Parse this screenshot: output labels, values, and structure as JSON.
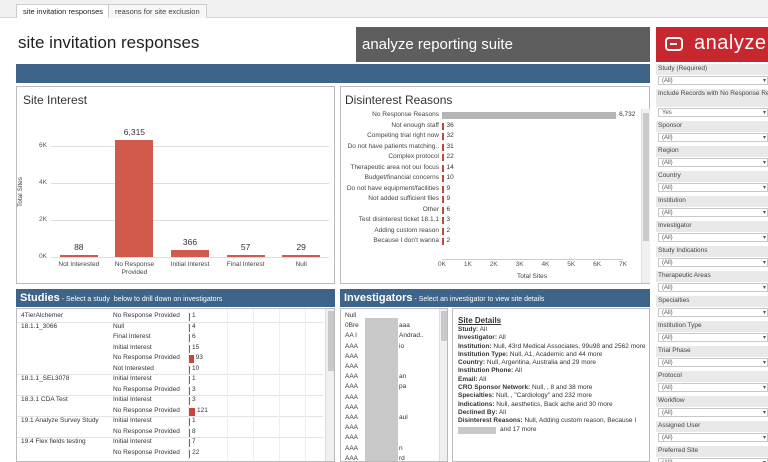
{
  "tabs": [
    {
      "label": "site invitation responses"
    },
    {
      "label": "reasons for site exclusion"
    }
  ],
  "header": {
    "title": "site invitation responses",
    "suite": "analyze reporting suite",
    "brand": "analyze"
  },
  "site_interest": {
    "title": "Site Interest",
    "ylabel": "Total Sites",
    "yticks": [
      "6K",
      "4K",
      "2K",
      "0K"
    ],
    "categories": [
      "Not Interested",
      "No Response Provided",
      "Initial Interest",
      "Final Interest",
      "Null"
    ],
    "value_labels": [
      "88",
      "6,315",
      "366",
      "57",
      "29"
    ],
    "chart_data": {
      "type": "bar",
      "categories": [
        "Not Interested",
        "No Response Provided",
        "Initial Interest",
        "Final Interest",
        "Null"
      ],
      "values": [
        88,
        6315,
        366,
        57,
        29
      ],
      "title": "Site Interest",
      "xlabel": "",
      "ylabel": "Total Sites",
      "ylim": [
        0,
        7000
      ]
    }
  },
  "disinterest": {
    "title": "Disinterest Reasons",
    "xlabel": "Total Sites",
    "xticks": [
      "0K",
      "1K",
      "2K",
      "3K",
      "4K",
      "5K",
      "6K",
      "7K"
    ],
    "labels": [
      "No Response Reasons",
      "Not enough staff",
      "Competing trial right now",
      "Do not have patients matching..",
      "Complex protocol",
      "Therapeutic area not our focus",
      "Budget/financial concerns",
      "Do not have equipment/facilities",
      "Not added sufficient files",
      "Other",
      "Test disinterest ticket 18.1.1",
      "Adding custom reason",
      "Because I don't wanna"
    ],
    "value_labels": [
      "6,732",
      "36",
      "32",
      "31",
      "22",
      "14",
      "10",
      "9",
      "9",
      "6",
      "3",
      "2",
      "2"
    ],
    "chart_data": {
      "type": "bar",
      "orientation": "horizontal",
      "categories": [
        "No Response Reasons",
        "Not enough staff",
        "Competing trial right now",
        "Do not have patients matching..",
        "Complex protocol",
        "Therapeutic area not our focus",
        "Budget/financial concerns",
        "Do not have equipment/facilities",
        "Not added sufficient files",
        "Other",
        "Test disinterest ticket 18.1.1",
        "Adding custom reason",
        "Because I don't wanna"
      ],
      "values": [
        6732,
        36,
        32,
        31,
        22,
        14,
        10,
        9,
        9,
        6,
        3,
        2,
        2
      ],
      "title": "Disinterest Reasons",
      "xlabel": "Total Sites",
      "xlim": [
        0,
        7000
      ]
    }
  },
  "studies": {
    "heading": "Studies",
    "subheading": "- Select a study  below to drill down on investigators",
    "rows": [
      {
        "study": "4TierAlchemer",
        "response": "No Response Provided",
        "count": "1",
        "frac": 0.008
      },
      {
        "study": "18.1.1_3066",
        "response": "Null",
        "count": "4",
        "frac": 0.03
      },
      {
        "study": "",
        "response": "Final Interest",
        "count": "6",
        "frac": 0.05
      },
      {
        "study": "",
        "response": "Initial Interest",
        "count": "15",
        "frac": 0.12
      },
      {
        "study": "",
        "response": "No Response Provided",
        "count": "93",
        "frac": 0.77
      },
      {
        "study": "",
        "response": "Not Interested",
        "count": "10",
        "frac": 0.08
      },
      {
        "study": "18.1.1_SEL3078",
        "response": "Initial Interest",
        "count": "1",
        "frac": 0.008
      },
      {
        "study": "",
        "response": "No Response Provided",
        "count": "3",
        "frac": 0.025
      },
      {
        "study": "18.3.1 CDA Test",
        "response": "Initial Interest",
        "count": "3",
        "frac": 0.025
      },
      {
        "study": "",
        "response": "No Response Provided",
        "count": "121",
        "frac": 1.0
      },
      {
        "study": "19.1 Analyze Survey Study",
        "response": "Initial Interest",
        "count": "1",
        "frac": 0.008
      },
      {
        "study": "",
        "response": "No Response Provided",
        "count": "8",
        "frac": 0.066
      },
      {
        "study": "19.4 Flex fields testing",
        "response": "Initial Interest",
        "count": "7",
        "frac": 0.058
      },
      {
        "study": "",
        "response": "No Response Provided",
        "count": "22",
        "frac": 0.18
      }
    ]
  },
  "investigators": {
    "heading": "Investigators",
    "subheading": "- Select an investigator to view site details",
    "rows": [
      {
        "col1": "Null",
        "col2": ""
      },
      {
        "col1": "0Bre",
        "col2": "aaa"
      },
      {
        "col1": "AA I",
        "col2": "Andrad.."
      },
      {
        "col1": "AAA",
        "col2": "io"
      },
      {
        "col1": "AAA",
        "col2": ""
      },
      {
        "col1": "AAA",
        "col2": ""
      },
      {
        "col1": "AAA",
        "col2": "an"
      },
      {
        "col1": "AAA",
        "col2": "pa"
      },
      {
        "col1": "AAA",
        "col2": ""
      },
      {
        "col1": "AAA",
        "col2": ""
      },
      {
        "col1": "AAA",
        "col2": "aul"
      },
      {
        "col1": "AAA",
        "col2": ""
      },
      {
        "col1": "AAA",
        "col2": ""
      },
      {
        "col1": "AAA",
        "col2": "n"
      },
      {
        "col1": "AAA",
        "col2": "rd"
      }
    ]
  },
  "site_details": {
    "title": "Site Details",
    "lines": [
      {
        "label": "Study:",
        "value": " All"
      },
      {
        "label": "Investigator:",
        "value": " All"
      },
      {
        "label": "Institution:",
        "value": " Null, 43rd Medical Associates, 99u98 and 2562 more"
      },
      {
        "label": "Institution Type:",
        "value": " Null, A1, Academic and 44 more"
      },
      {
        "label": "Country:",
        "value": " Null, Argentina, Australia and 29 more"
      },
      {
        "label": "Institution Phone:",
        "value": " All"
      },
      {
        "label": "Email:",
        "value": " All"
      },
      {
        "label": "CRO Sponsor Network:",
        "value": " Null, , 8 and 38 more"
      },
      {
        "label": "Specialties:",
        "value": " Null, , \"Cardiology\" and 232 more"
      },
      {
        "label": "Indications:",
        "value": " Null, aesthetics, Back ache and 30 more"
      },
      {
        "label": "Declined By:",
        "value": " All"
      },
      {
        "label": "Disinterest Reasons:",
        "value": " Null, Adding custom reason, Because I"
      }
    ],
    "last_line": "and 17 more"
  },
  "filters": [
    {
      "label": "Study (Required)",
      "value": "(All)"
    },
    {
      "label": "Include Records with No Response Reasons",
      "value": "Yes"
    },
    {
      "label": "Sponsor",
      "value": "(All)"
    },
    {
      "label": "Region",
      "value": "(All)"
    },
    {
      "label": "Country",
      "value": "(All)"
    },
    {
      "label": "Institution",
      "value": "(All)"
    },
    {
      "label": "Investigator",
      "value": "(All)"
    },
    {
      "label": "Study Indications",
      "value": "(All)"
    },
    {
      "label": "Therapeutic Areas",
      "value": "(All)"
    },
    {
      "label": "Specialties",
      "value": "(All)"
    },
    {
      "label": "Institution Type",
      "value": "(All)"
    },
    {
      "label": "Trial Phase",
      "value": "(All)"
    },
    {
      "label": "Protocol",
      "value": "(All)"
    },
    {
      "label": "Workflow",
      "value": "(All)"
    },
    {
      "label": "Assigned User",
      "value": "(All)"
    },
    {
      "label": "Preferred Site",
      "value": "(All)"
    }
  ],
  "colors": {
    "accent_blue": "#3f648a",
    "bar_red": "#d05a4c",
    "brand_red": "#c8272f",
    "bar_gray": "#b5b5b5"
  }
}
